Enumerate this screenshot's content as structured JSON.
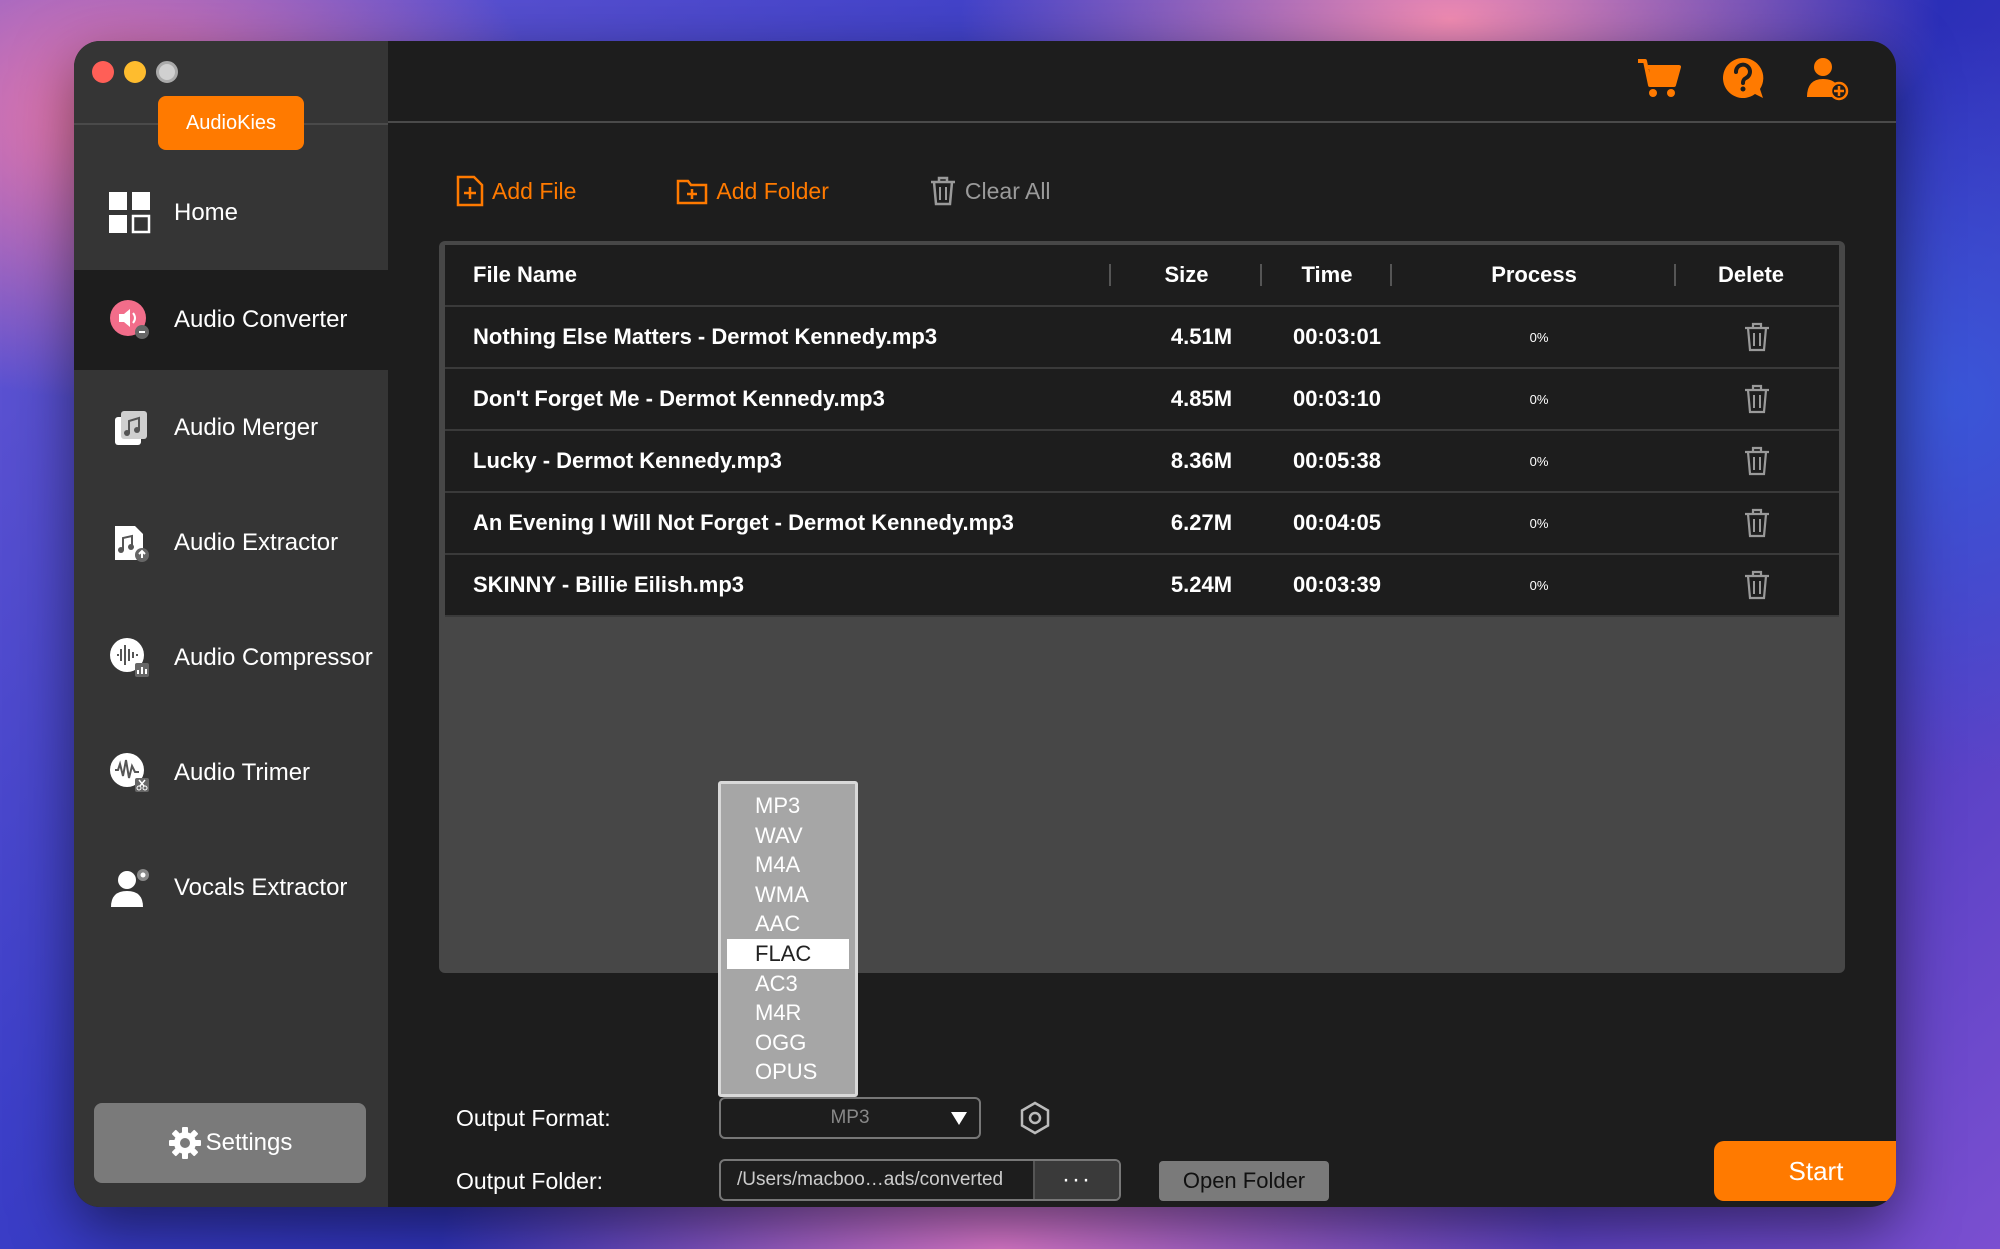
{
  "app": {
    "brand": "AudioKies"
  },
  "sidebar": {
    "items": [
      {
        "label": "Home",
        "icon": "grid-icon"
      },
      {
        "label": "Audio Converter",
        "icon": "audio-converter-icon"
      },
      {
        "label": "Audio Merger",
        "icon": "audio-merger-icon"
      },
      {
        "label": "Audio Extractor",
        "icon": "audio-extractor-icon"
      },
      {
        "label": "Audio Compressor",
        "icon": "audio-compressor-icon"
      },
      {
        "label": "Audio Trimer",
        "icon": "audio-trimmer-icon"
      },
      {
        "label": "Vocals Extractor",
        "icon": "vocals-extractor-icon"
      }
    ],
    "active": "Audio Converter",
    "settings_label": "Settings"
  },
  "toolbar": {
    "add_file": "Add File",
    "add_folder": "Add Folder",
    "clear_all": "Clear All"
  },
  "table": {
    "columns": [
      "File Name",
      "Size",
      "Time",
      "Process",
      "Delete"
    ],
    "rows": [
      {
        "name": "Nothing Else Matters - Dermot Kennedy.mp3",
        "size": "4.51M",
        "time": "00:03:01",
        "process": "0%"
      },
      {
        "name": "Don't Forget Me - Dermot Kennedy.mp3",
        "size": "4.85M",
        "time": "00:03:10",
        "process": "0%"
      },
      {
        "name": "Lucky - Dermot Kennedy.mp3",
        "size": "8.36M",
        "time": "00:05:38",
        "process": "0%"
      },
      {
        "name": "An Evening I Will Not Forget - Dermot Kennedy.mp3",
        "size": "6.27M",
        "time": "00:04:05",
        "process": "0%"
      },
      {
        "name": "SKINNY - Billie Eilish.mp3",
        "size": "5.24M",
        "time": "00:03:39",
        "process": "0%"
      }
    ]
  },
  "format": {
    "label": "Output Format:",
    "selected": "MP3",
    "options": [
      "MP3",
      "WAV",
      "M4A",
      "WMA",
      "AAC",
      "FLAC",
      "AC3",
      "M4R",
      "OGG",
      "OPUS"
    ],
    "highlighted": "FLAC"
  },
  "folder": {
    "label": "Output Folder:",
    "path": "/Users/macboo…ads/converted",
    "more": "···",
    "open_label": "Open Folder"
  },
  "start_label": "Start",
  "colors": {
    "accent": "#ff7a00",
    "sidebar": "#353535",
    "main": "#1d1d1d",
    "panel": "#474747"
  }
}
